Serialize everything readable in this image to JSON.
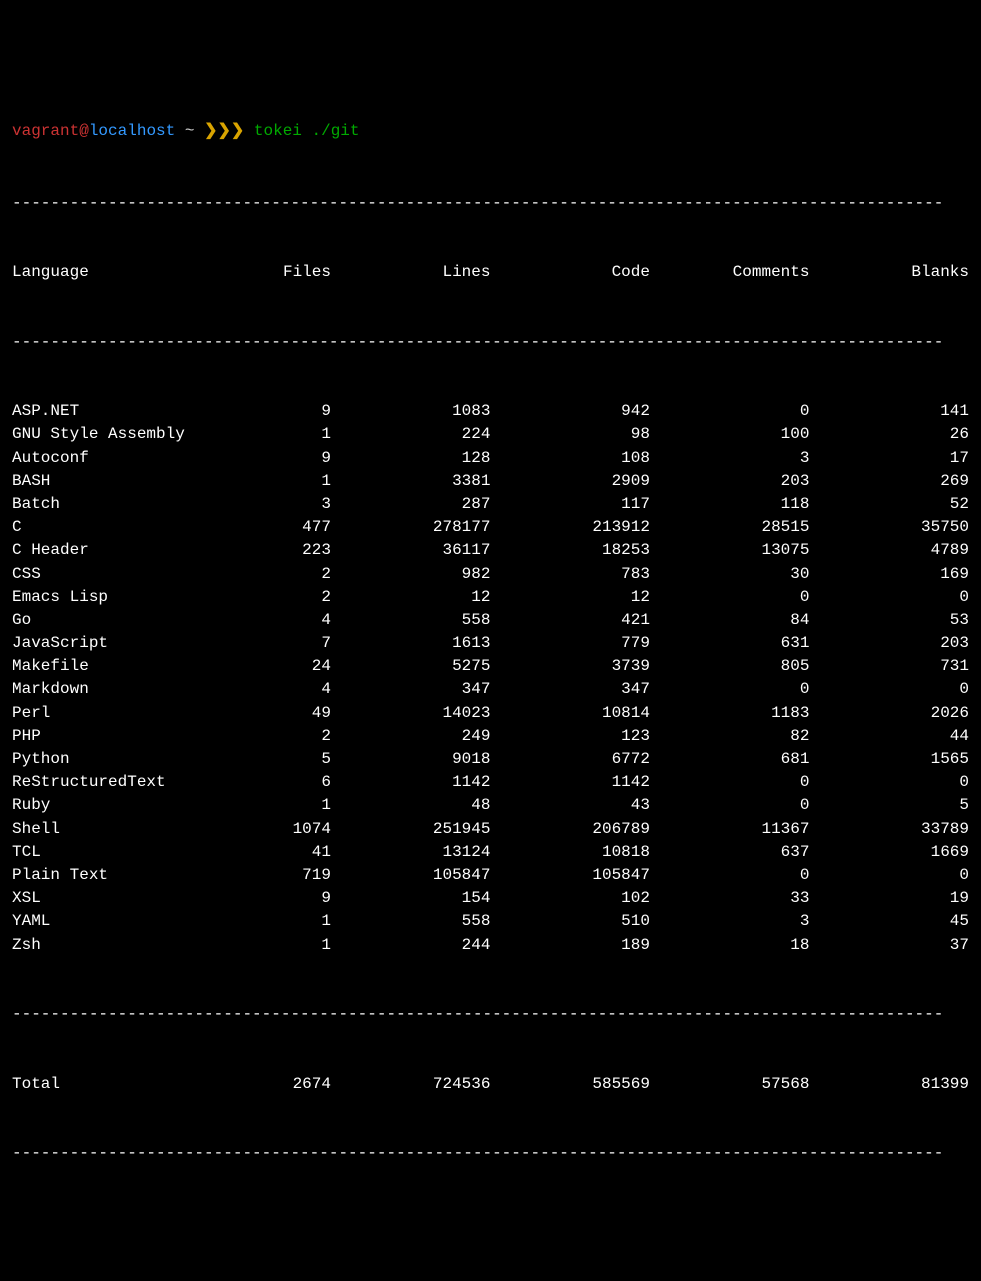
{
  "prompt": {
    "user": "vagrant",
    "at": "@",
    "host": "localhost",
    "path": " ~ ",
    "chevrons": "❯❯❯ ",
    "command": "tokei ./git"
  },
  "separator": "-------------------------------------------------------------------------------------------------",
  "headers": {
    "language": "Language",
    "files": "Files",
    "lines": "Lines",
    "code": "Code",
    "comments": "Comments",
    "blanks": "Blanks"
  },
  "rows": [
    {
      "language": "ASP.NET",
      "files": "9",
      "lines": "1083",
      "code": "942",
      "comments": "0",
      "blanks": "141"
    },
    {
      "language": "GNU Style Assembly",
      "files": "1",
      "lines": "224",
      "code": "98",
      "comments": "100",
      "blanks": "26"
    },
    {
      "language": "Autoconf",
      "files": "9",
      "lines": "128",
      "code": "108",
      "comments": "3",
      "blanks": "17"
    },
    {
      "language": "BASH",
      "files": "1",
      "lines": "3381",
      "code": "2909",
      "comments": "203",
      "blanks": "269"
    },
    {
      "language": "Batch",
      "files": "3",
      "lines": "287",
      "code": "117",
      "comments": "118",
      "blanks": "52"
    },
    {
      "language": "C",
      "files": "477",
      "lines": "278177",
      "code": "213912",
      "comments": "28515",
      "blanks": "35750"
    },
    {
      "language": "C Header",
      "files": "223",
      "lines": "36117",
      "code": "18253",
      "comments": "13075",
      "blanks": "4789"
    },
    {
      "language": "CSS",
      "files": "2",
      "lines": "982",
      "code": "783",
      "comments": "30",
      "blanks": "169"
    },
    {
      "language": "Emacs Lisp",
      "files": "2",
      "lines": "12",
      "code": "12",
      "comments": "0",
      "blanks": "0"
    },
    {
      "language": "Go",
      "files": "4",
      "lines": "558",
      "code": "421",
      "comments": "84",
      "blanks": "53"
    },
    {
      "language": "JavaScript",
      "files": "7",
      "lines": "1613",
      "code": "779",
      "comments": "631",
      "blanks": "203"
    },
    {
      "language": "Makefile",
      "files": "24",
      "lines": "5275",
      "code": "3739",
      "comments": "805",
      "blanks": "731"
    },
    {
      "language": "Markdown",
      "files": "4",
      "lines": "347",
      "code": "347",
      "comments": "0",
      "blanks": "0"
    },
    {
      "language": "Perl",
      "files": "49",
      "lines": "14023",
      "code": "10814",
      "comments": "1183",
      "blanks": "2026"
    },
    {
      "language": "PHP",
      "files": "2",
      "lines": "249",
      "code": "123",
      "comments": "82",
      "blanks": "44"
    },
    {
      "language": "Python",
      "files": "5",
      "lines": "9018",
      "code": "6772",
      "comments": "681",
      "blanks": "1565"
    },
    {
      "language": "ReStructuredText",
      "files": "6",
      "lines": "1142",
      "code": "1142",
      "comments": "0",
      "blanks": "0"
    },
    {
      "language": "Ruby",
      "files": "1",
      "lines": "48",
      "code": "43",
      "comments": "0",
      "blanks": "5"
    },
    {
      "language": "Shell",
      "files": "1074",
      "lines": "251945",
      "code": "206789",
      "comments": "11367",
      "blanks": "33789"
    },
    {
      "language": "TCL",
      "files": "41",
      "lines": "13124",
      "code": "10818",
      "comments": "637",
      "blanks": "1669"
    },
    {
      "language": "Plain Text",
      "files": "719",
      "lines": "105847",
      "code": "105847",
      "comments": "0",
      "blanks": "0"
    },
    {
      "language": "XSL",
      "files": "9",
      "lines": "154",
      "code": "102",
      "comments": "33",
      "blanks": "19"
    },
    {
      "language": "YAML",
      "files": "1",
      "lines": "558",
      "code": "510",
      "comments": "3",
      "blanks": "45"
    },
    {
      "language": "Zsh",
      "files": "1",
      "lines": "244",
      "code": "189",
      "comments": "18",
      "blanks": "37"
    }
  ],
  "total": {
    "label": "Total",
    "files": "2674",
    "lines": "724536",
    "code": "585569",
    "comments": "57568",
    "blanks": "81399"
  }
}
